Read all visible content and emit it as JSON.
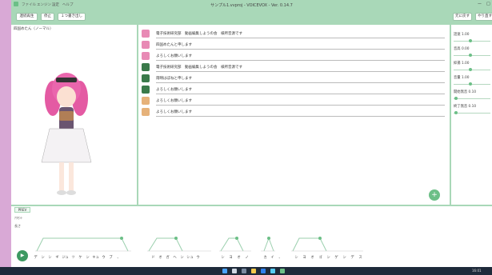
{
  "titlebar": {
    "menus": [
      "ファイル",
      "エンジン",
      "設定",
      "ヘルプ"
    ],
    "title": "サンプル1.vvproj - VOICEVOX - Ver. 0.14.7",
    "controls": [
      "ー",
      "□"
    ]
  },
  "toolbar": {
    "play_all": "連続再生",
    "stop": "停止",
    "export_one": "１つ書き出し",
    "undo": "元に戻す",
    "redo": "やり直す"
  },
  "character": {
    "name": "四国めたん（ノーマル）"
  },
  "utterances": [
    {
      "text": "電子技術研究部　動画編集しようの会　様所音源です",
      "icon": "#e88ab5"
    },
    {
      "text": "四国めたんと申します",
      "icon": "#e88ab5"
    },
    {
      "text": "よろしくお願いします",
      "icon": "#e88ab5"
    },
    {
      "text": "電子技術研究部　動画編集しようの会　様所音源です",
      "icon": "#3a7a4a"
    },
    {
      "text": "雨晴はぼねと申します",
      "icon": "#3a7a4a"
    },
    {
      "text": "よろしくお願いします",
      "icon": "#3a7a4a"
    },
    {
      "text": "よろしくお願いします",
      "icon": "#e6b27a"
    },
    {
      "text": "よろしくお願いします",
      "icon": "#e6b27a"
    }
  ],
  "add_button": "+",
  "params": [
    {
      "label": "話速 1.00",
      "level": 0.5
    },
    {
      "label": "音高 0.00",
      "level": 0.5
    },
    {
      "label": "抑揚 1.00",
      "level": 0.5
    },
    {
      "label": "音量 1.00",
      "level": 0.5
    },
    {
      "label": "開始無音 0.10",
      "level": 0.1
    },
    {
      "label": "終了無音 0.10",
      "level": 0.1
    }
  ],
  "bottom": {
    "tab": "PREV",
    "row1": "ｱｸｾﾝﾄ",
    "row2": "長さ",
    "play": "▶",
    "kana": [
      "デ",
      "ン",
      "シ",
      "ギ",
      "ジュ",
      "ツ",
      "ケ",
      "ン",
      "キュ",
      "ウ",
      "ブ",
      "、",
      "ド",
      "オ",
      "ガ",
      "ヘ",
      "ン",
      "シュ",
      "ウ",
      "シ",
      "ヨ",
      "オ",
      "ノ",
      "カ",
      "イ",
      "、",
      "シ",
      "ヨ",
      "オ",
      "ゴ",
      "ン",
      "ゲ",
      "ン",
      "デ",
      "ス"
    ]
  },
  "taskbar": {
    "time": "16:01",
    "date": "2023/02/11"
  }
}
